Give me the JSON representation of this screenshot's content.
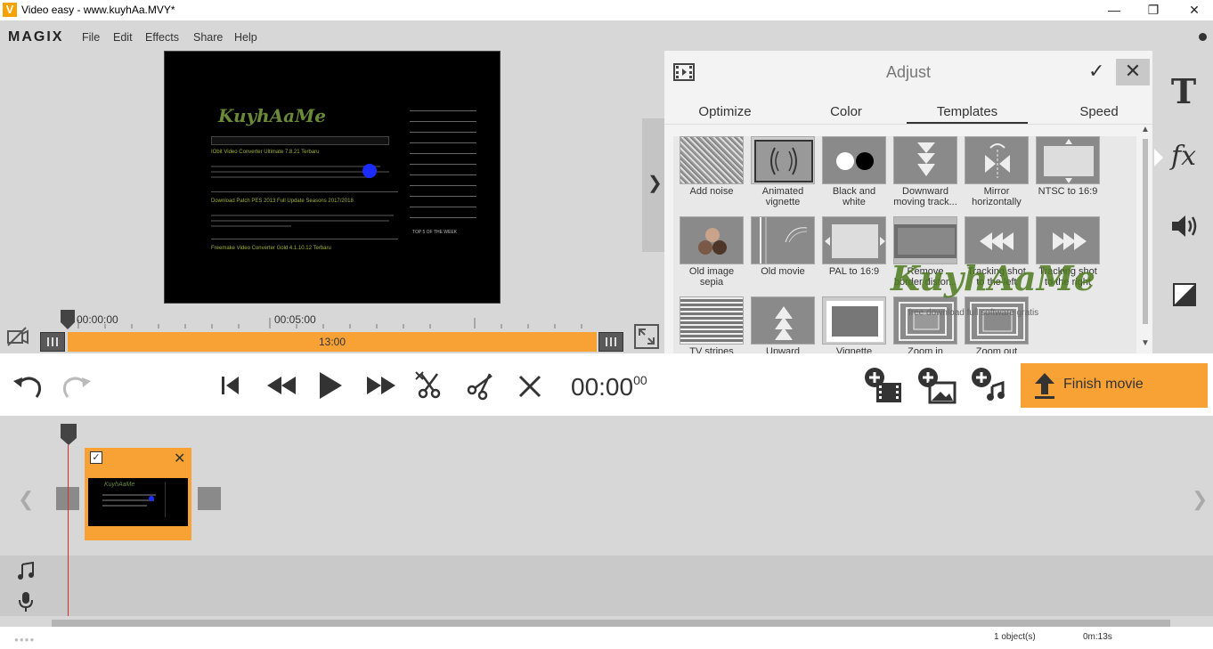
{
  "window": {
    "app_icon": "V",
    "title": "Video easy - www.kuyhAa.MVY*",
    "buttons": {
      "minimize": "—",
      "maximize": "❐",
      "close": "✕"
    }
  },
  "menubar": {
    "logo": "MAGIX",
    "items": [
      "File",
      "Edit",
      "Effects",
      "Share",
      "Help"
    ]
  },
  "preview": {
    "site_title": "KuyhAaMe",
    "posts": [
      "IObit Video Converter Ultimate 7.8.21 Terbaru",
      "Download Patch PES 2013 Full Update Seasons 2017/2018",
      "Freemake Video Converter Gold 4.1.10.12 Terbaru"
    ],
    "sidebar_heading": "TOP 5 OF THE WEEK"
  },
  "ruler": {
    "start": "00:00:00",
    "mid": "00:05:00"
  },
  "trim_bar": {
    "duration": "13:00"
  },
  "adjust_panel": {
    "title": "Adjust",
    "tabs": [
      "Optimize",
      "Color",
      "Templates",
      "Speed"
    ],
    "active_tab": "Templates",
    "templates": [
      [
        "Add noise",
        ""
      ],
      [
        "Animated",
        "vignette"
      ],
      [
        "Black and",
        "white"
      ],
      [
        "Downward",
        "moving track..."
      ],
      [
        "Mirror",
        "horizontally"
      ],
      [
        "NTSC to 16:9",
        ""
      ],
      [
        "Old image",
        "sepia"
      ],
      [
        "Old movie",
        ""
      ],
      [
        "PAL to 16:9",
        ""
      ],
      [
        "Remove",
        "border distor..."
      ],
      [
        "Tracking shot",
        "to the left"
      ],
      [
        "Tracking shot",
        "to the right"
      ],
      [
        "TV stripes",
        ""
      ],
      [
        "Upward",
        ""
      ],
      [
        "Vignette",
        ""
      ],
      [
        "Zoom in",
        ""
      ],
      [
        "Zoom out",
        ""
      ]
    ]
  },
  "watermark": {
    "text": "KuyhAaMe",
    "sub": "free download full software gratis"
  },
  "right_toolbar": {
    "icons": [
      "text-icon",
      "fx-icon",
      "volume-icon",
      "contrast-icon"
    ],
    "fx_label": "fx",
    "text_label": "T"
  },
  "transport": {
    "timecode_main": "00:00",
    "timecode_frames": "00",
    "finish_label": "Finish movie"
  },
  "status": {
    "objects": "1 object(s)",
    "duration": "0m:13s"
  },
  "colors": {
    "accent": "#f8a236",
    "playhead": "#d82a2a"
  }
}
